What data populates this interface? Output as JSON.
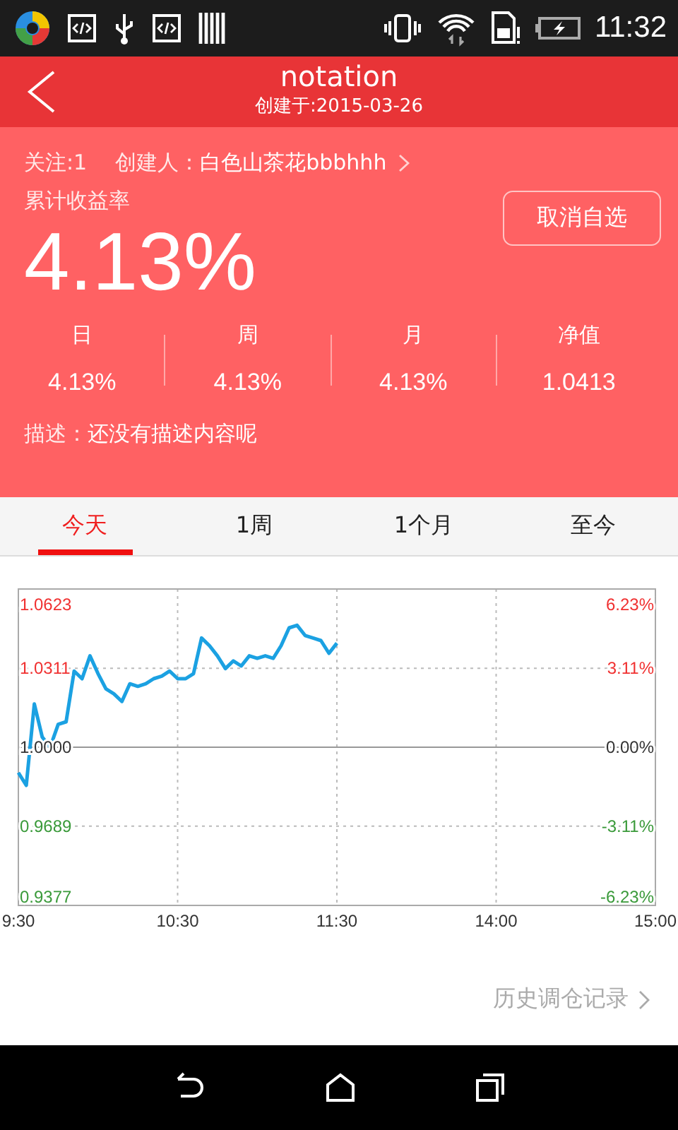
{
  "status_bar": {
    "time": "11:32"
  },
  "header": {
    "title": "notation",
    "subtitle": "创建于:2015-03-26"
  },
  "summary": {
    "follow": "关注:1",
    "creator_label": "创建人：",
    "creator_name": "白色山茶花bbbhhh",
    "return_label": "累计收益率",
    "return_value": "4.13%",
    "button": "取消自选",
    "stats": [
      {
        "label": "日",
        "value": "4.13%"
      },
      {
        "label": "周",
        "value": "4.13%"
      },
      {
        "label": "月",
        "value": "4.13%"
      },
      {
        "label": "净值",
        "value": "1.0413"
      }
    ],
    "description_label": "描述：",
    "description": "还没有描述内容呢"
  },
  "tabs": [
    {
      "label": "今天",
      "selected": true
    },
    {
      "label": "1周",
      "selected": false
    },
    {
      "label": "1个月",
      "selected": false
    },
    {
      "label": "至今",
      "selected": false
    }
  ],
  "chart": {
    "chart_data": {
      "type": "line",
      "categories": [
        "9:30",
        null,
        null,
        null,
        null,
        null,
        null,
        null,
        null,
        null,
        null,
        null,
        null,
        null,
        null,
        null,
        null,
        null,
        null,
        null,
        "10:30",
        null,
        null,
        null,
        null,
        null,
        null,
        null,
        null,
        null,
        null,
        null,
        null,
        null,
        null,
        null,
        null,
        null,
        null,
        null,
        "11:30",
        null,
        null,
        null,
        null,
        null,
        null,
        null,
        null,
        null,
        null,
        null,
        null,
        null,
        null,
        null,
        null,
        null,
        null,
        null,
        "14:00",
        null,
        null,
        null,
        null,
        null,
        null,
        null,
        null,
        null,
        null,
        null,
        null,
        null,
        null,
        null,
        null,
        null,
        null,
        null,
        "15:00"
      ],
      "series": [
        {
          "color": "#1ba1e2",
          "values": [
            0.99,
            0.985,
            1.017,
            1.004,
            1.0,
            1.009,
            1.01,
            1.03,
            1.027,
            1.036,
            1.029,
            1.023,
            1.021,
            1.018,
            1.025,
            1.024,
            1.025,
            1.027,
            1.028,
            1.03,
            1.027,
            1.027,
            1.029,
            1.043,
            1.04,
            1.036,
            1.031,
            1.034,
            1.032,
            1.036,
            1.035,
            1.036,
            1.035,
            1.04,
            1.047,
            1.048,
            1.044,
            1.043,
            1.042,
            1.037,
            1.041,
            null,
            null,
            null,
            null,
            null,
            null,
            null,
            null,
            null,
            null,
            null,
            null,
            null,
            null,
            null,
            null,
            null,
            null,
            null,
            null,
            null,
            null,
            null,
            null,
            null,
            null,
            null,
            null,
            null,
            null,
            null,
            null,
            null,
            null,
            null,
            null,
            null,
            null,
            null,
            null
          ]
        }
      ],
      "ylim": [
        0.9377,
        1.0623
      ],
      "grid": true,
      "ref_lines": [
        {
          "axis": "y",
          "value": 1.0
        }
      ],
      "yticks": [
        {
          "value": 1.0623,
          "label": "1.0623"
        },
        {
          "value": 1.0311,
          "label": "1.0311"
        },
        {
          "value": 1.0,
          "label": "1.0000"
        },
        {
          "value": 0.9689,
          "label": "0.9689"
        },
        {
          "value": 0.9377,
          "label": "0.9377"
        }
      ]
    },
    "right_labels": [
      "6.23%",
      "3.11%",
      "0.00%",
      "-3.11%",
      "-6.23%"
    ]
  },
  "history_link": "历史调仓记录"
}
